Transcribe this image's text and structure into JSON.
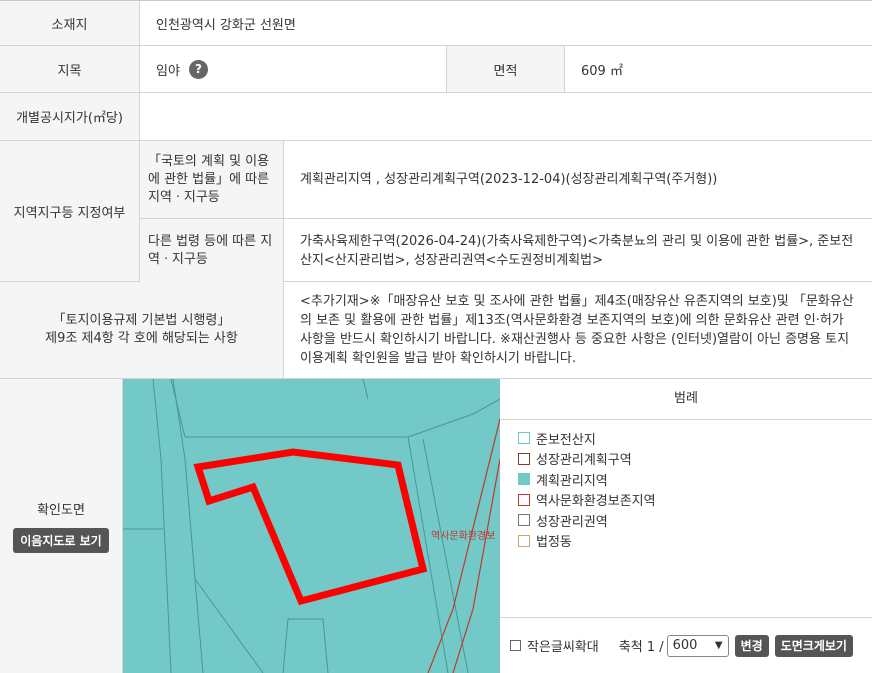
{
  "location": {
    "label": "소재지",
    "value": "인천광역시 강화군 선원면"
  },
  "land": {
    "label": "지목",
    "value": "임야",
    "help_icon": "?",
    "area_label": "면적",
    "area_value": "609 ㎡"
  },
  "price": {
    "label": "개별공시지가(㎡당)",
    "value": ""
  },
  "zoning": {
    "label": "지역지구등 지정여부",
    "row1_label": "「국토의 계획 및 이용에 관한 법률」에 따른 지역ㆍ지구등",
    "row1_value": "계획관리지역 , 성장관리계획구역(2023-12-04)(성장관리계획구역(주거형))",
    "row2_label": "다른 법령 등에 따른 지역ㆍ지구등",
    "row2_value": "가축사육제한구역(2026-04-24)(가축사육제한구역)<가축분뇨의 관리 및 이용에 관한 법률>, 준보전산지<산지관리법>, 성장관리권역<수도권정비계획법>"
  },
  "regulation": {
    "label_line1": "「토지이용규제 기본법 시행령」",
    "label_line2": "제9조 제4항 각 호에 해당되는 사항",
    "value": "<추가기재>※「매장유산 보호 및 조사에 관한 법률」제4조(매장유산 유존지역의 보호)및 「문화유산의 보존 및 활용에 관한 법률」제13조(역사문화환경 보존지역의 보호)에 의한 문화유산 관련 인·허가 사항을 반드시 확인하시기 바랍니다. ※재산권행사 등 중요한 사항은 (인터넷)열람이 아닌 증명용 토지이용계획 확인원을 발급 받아 확인하시기 바랍니다."
  },
  "map": {
    "label": "확인도면",
    "view_button": "이음지도로 보기",
    "map_label": "역사문화환경보",
    "colors": {
      "zone": "#72c9c7",
      "parcel": "#ff0000"
    }
  },
  "legend": {
    "title": "범례",
    "items": [
      {
        "label": "준보전산지",
        "fill": "#ffffff",
        "border": "#72c9c7"
      },
      {
        "label": "성장관리계획구역",
        "fill": "#ffffff",
        "border": "#8b3a2a"
      },
      {
        "label": "계획관리지역",
        "fill": "#72c9c7",
        "border": "#72c9c7"
      },
      {
        "label": "역사문화환경보존지역",
        "fill": "#ffffff",
        "border": "#c0392b"
      },
      {
        "label": "성장관리권역",
        "fill": "#ffffff",
        "border": "#777777"
      },
      {
        "label": "법정동",
        "fill": "#ffffff",
        "border": "#c8a878"
      }
    ]
  },
  "controls": {
    "zoom_text_label": "작은글씨확대",
    "scale_label": "축척 1 /",
    "scale_value": "600",
    "change_button": "변경",
    "print_button": "도면크게보기"
  }
}
